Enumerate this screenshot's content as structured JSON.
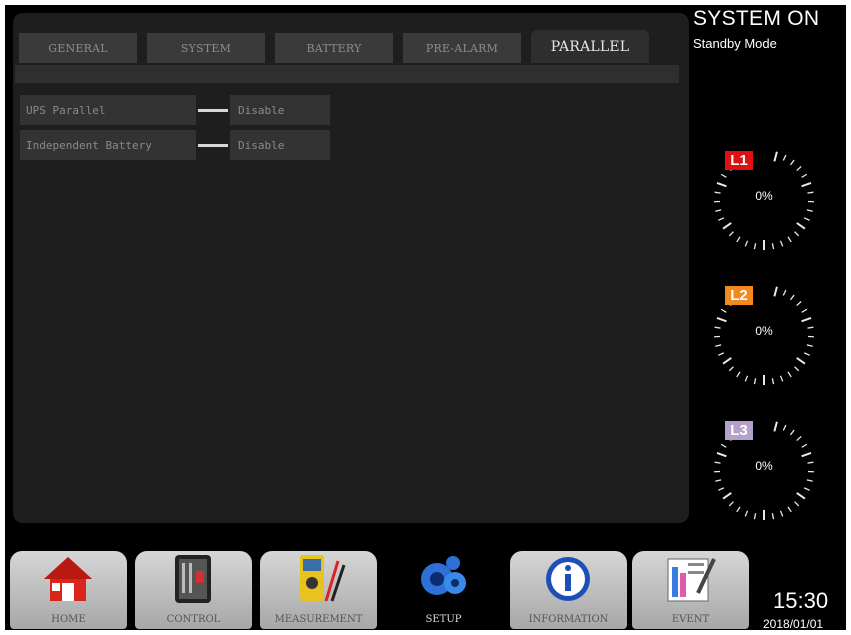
{
  "tabs": [
    {
      "label": "GENERAL",
      "active": false
    },
    {
      "label": "SYSTEM",
      "active": false
    },
    {
      "label": "BATTERY",
      "active": false
    },
    {
      "label": "PRE-ALARM",
      "active": false
    },
    {
      "label": "PARALLEL",
      "active": true
    }
  ],
  "settings": [
    {
      "label": "UPS Parallel",
      "value": "Disable"
    },
    {
      "label": "Independent Battery",
      "value": "Disable"
    }
  ],
  "status": {
    "title": "SYSTEM ON",
    "mode": "Standby Mode"
  },
  "gauges": [
    {
      "label": "L1",
      "value": "0%",
      "color": "#e01010"
    },
    {
      "label": "L2",
      "value": "0%",
      "color": "#f08a1e"
    },
    {
      "label": "L3",
      "value": "0%",
      "color": "#b4a0c8"
    }
  ],
  "nav": [
    {
      "label": "HOME",
      "icon": "home-icon",
      "active": false
    },
    {
      "label": "CONTROL",
      "icon": "control-icon",
      "active": false
    },
    {
      "label": "MEASUREMENT",
      "icon": "multimeter-icon",
      "active": false
    },
    {
      "label": "SETUP",
      "icon": "gears-icon",
      "active": true
    },
    {
      "label": "INFORMATION",
      "icon": "info-icon",
      "active": false
    },
    {
      "label": "EVENT",
      "icon": "event-log-icon",
      "active": false
    }
  ],
  "clock": {
    "time": "15:30",
    "date": "2018/01/01"
  }
}
